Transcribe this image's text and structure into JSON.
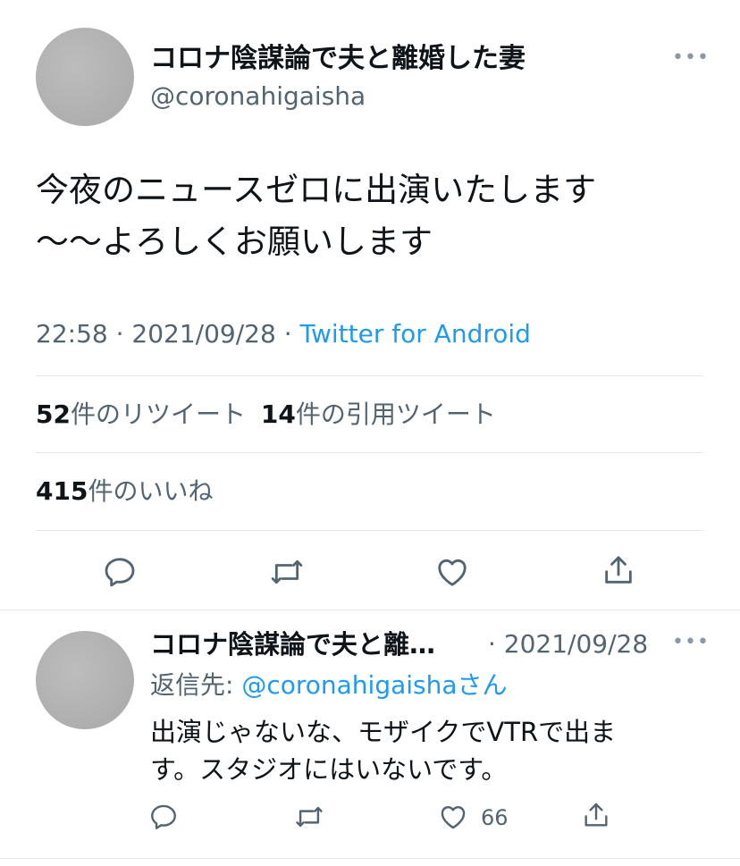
{
  "main_tweet": {
    "display_name": "コロナ陰謀論で夫と離婚した妻",
    "handle": "@coronahigaisha",
    "text_line1": "今夜のニュースゼロに出演いたします",
    "text_line2": "〜〜よろしくお願いします",
    "time": "22:58",
    "date": "2021/09/28",
    "source": "Twitter for Android",
    "separator": "·",
    "retweets_count": "52",
    "retweets_label": "件のリツイート",
    "quotes_count": "14",
    "quotes_label": "件の引用ツイート",
    "likes_count": "415",
    "likes_label": "件のいいね",
    "more": "•••"
  },
  "reply_tweet": {
    "display_name": "コロナ陰謀論で夫と離…",
    "date": "· 2021/09/28",
    "reply_prefix": "返信先: ",
    "reply_to": "@coronahigaisha",
    "reply_suffix": "さん",
    "text_line1": "出演じゃないな、モザイクでVTRで出ま",
    "text_line2": "す。スタジオにはいないです。",
    "like_count": "66",
    "more": "•••"
  },
  "icons": {
    "reply": "reply-icon",
    "retweet": "retweet-icon",
    "like": "heart-icon",
    "share": "share-icon"
  },
  "colors": {
    "text": "#0f1419",
    "muted": "#536471",
    "link": "#1d9bf0",
    "divider": "#e6e9eb"
  }
}
